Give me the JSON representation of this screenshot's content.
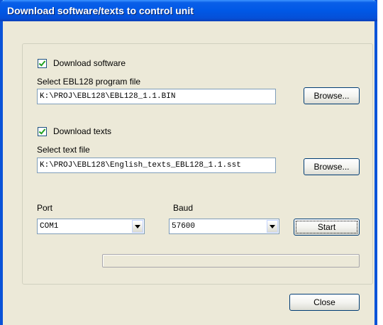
{
  "window": {
    "title": "Download software/texts to control unit"
  },
  "software": {
    "checkbox_label": "Download software",
    "checked": true,
    "file_label": "Select EBL128 program file",
    "file_value": "K:\\PROJ\\EBL128\\EBL128_1.1.BIN",
    "browse_label": "Browse..."
  },
  "texts": {
    "checkbox_label": "Download texts",
    "checked": true,
    "file_label": "Select text file",
    "file_value": "K:\\PROJ\\EBL128\\English_texts_EBL128_1.1.sst",
    "browse_label": "Browse..."
  },
  "port": {
    "label": "Port",
    "value": "COM1"
  },
  "baud": {
    "label": "Baud",
    "value": "57600"
  },
  "start_label": "Start",
  "progress": {
    "fraction": 0
  },
  "close_label": "Close",
  "colors": {
    "titlebar": "#0058e6",
    "dialog_bg": "#ece9d8",
    "check_mark": "#21a121"
  }
}
